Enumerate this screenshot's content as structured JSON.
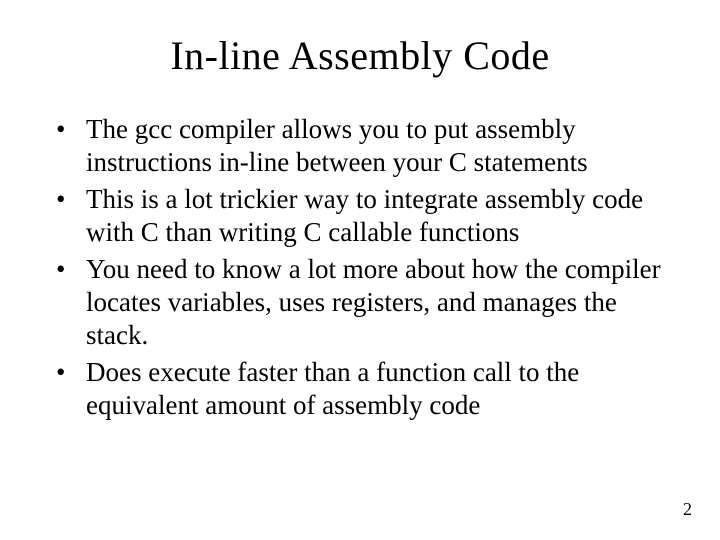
{
  "title": "In-line Assembly  Code",
  "bullets": [
    "The gcc compiler allows you to put assembly instructions in-line between your C statements",
    "This is a lot trickier way to integrate assembly code with C than writing C callable functions",
    "You need to know a lot more about how the compiler locates variables, uses registers, and manages the stack.",
    "Does execute faster than a function call to the equivalent amount of assembly code"
  ],
  "pageNumber": "2"
}
